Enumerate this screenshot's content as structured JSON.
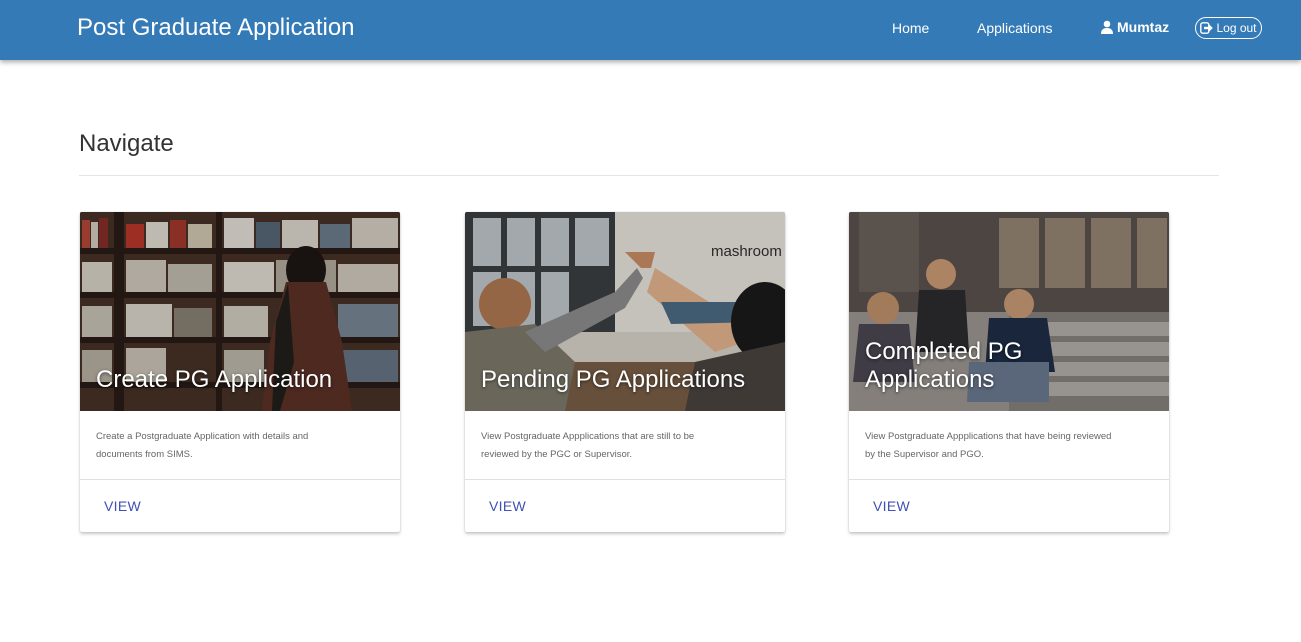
{
  "navbar": {
    "brand": "Post Graduate Application",
    "links": [
      {
        "label": "Home"
      },
      {
        "label": "Applications"
      }
    ],
    "user": {
      "name": "Mumtaz",
      "icon": "user-icon"
    },
    "logout": {
      "label": "Log out",
      "icon": "logout-icon"
    },
    "background": "#337ab7"
  },
  "page": {
    "title": "Navigate"
  },
  "cards": [
    {
      "title": "Create PG Application",
      "description": "Create a Postgraduate Application with details and documents from SIMS.",
      "action": "VIEW",
      "image": "library-bookshelf-photo"
    },
    {
      "title": "Pending PG Applications",
      "description": "View Postgraduate Appplications that are still to be reviewed by the PGC or Supervisor.",
      "action": "VIEW",
      "image": "team-high-five-photo"
    },
    {
      "title": "Completed PG Applications",
      "description": "View Postgraduate Appplications that have being reviewed by the Supervisor and PGO.",
      "action": "VIEW",
      "image": "students-on-steps-photo"
    }
  ],
  "colors": {
    "link": "#3f51b5",
    "text": "#333333",
    "muted": "#666666"
  }
}
